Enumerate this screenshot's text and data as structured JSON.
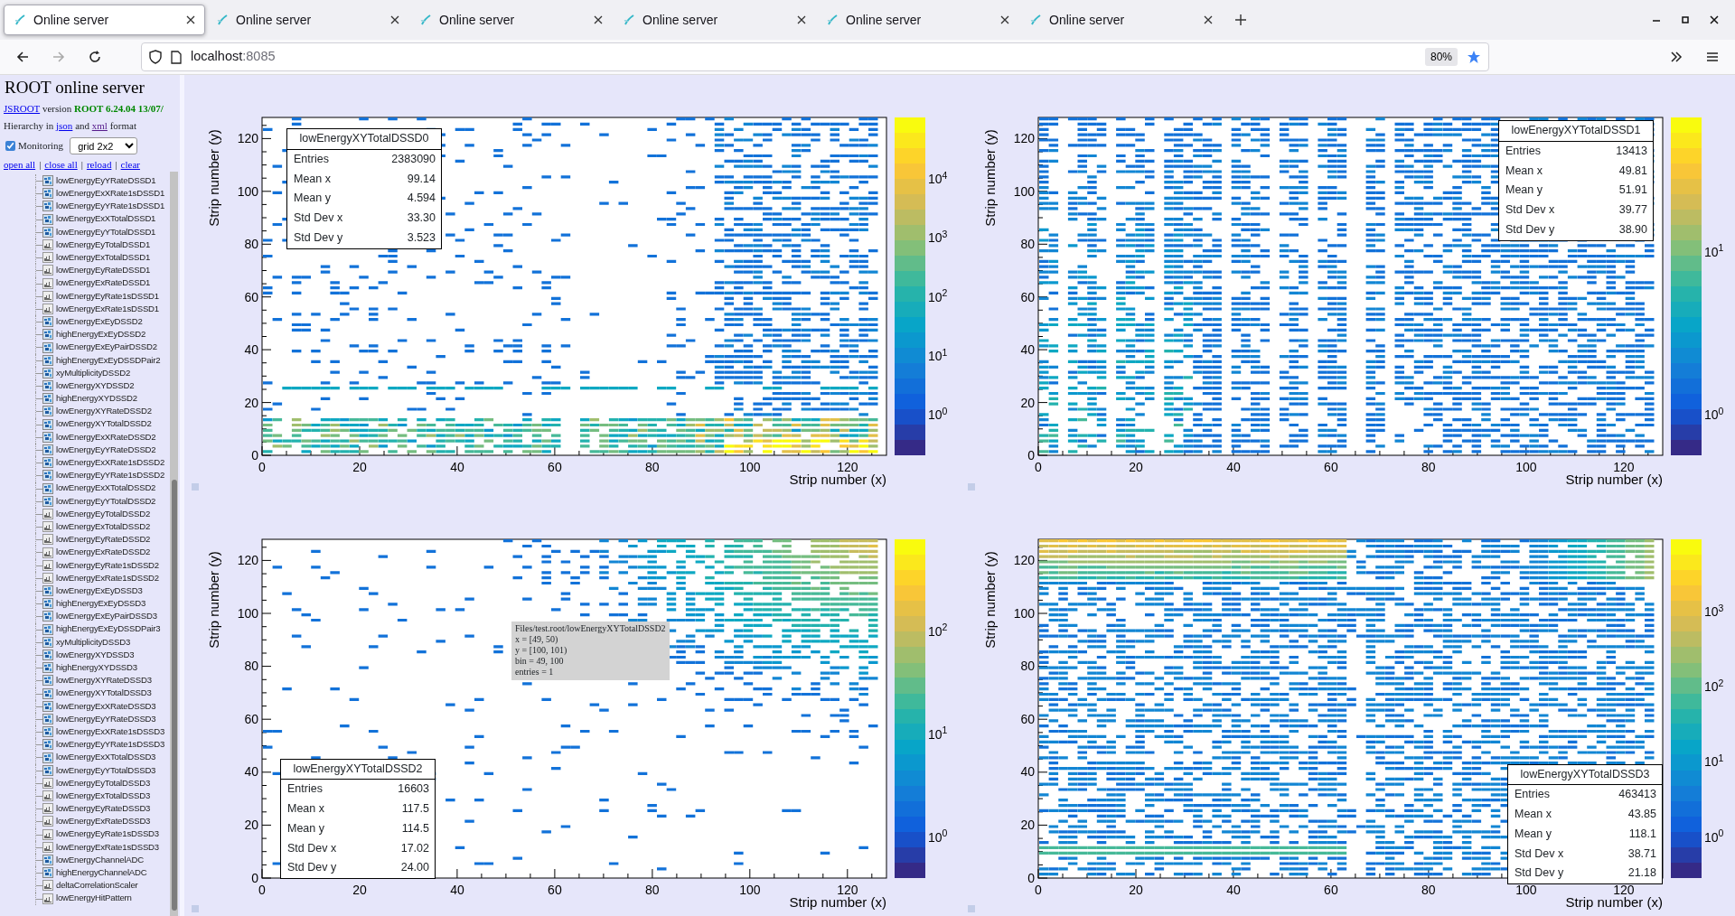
{
  "browser": {
    "tabs": [
      {
        "title": "Online server",
        "selected": true
      },
      {
        "title": "Online server",
        "selected": false
      },
      {
        "title": "Online server",
        "selected": false
      },
      {
        "title": "Online server",
        "selected": false
      },
      {
        "title": "Online server",
        "selected": false
      },
      {
        "title": "Online server",
        "selected": false
      }
    ],
    "url_host": "localhost",
    "url_port": ":8085",
    "zoom": "80%"
  },
  "sidebar": {
    "title": "ROOT online server",
    "version": {
      "link": "JSROOT",
      "text": "version",
      "release": "ROOT 6.24.04 13/07/"
    },
    "hierarchy": {
      "prefix": "Hierarchy in",
      "link_json": "json",
      "middle": "and",
      "link_xml": "xml",
      "suffix": "format"
    },
    "monitoring": {
      "label": "Monitoring",
      "checked": true
    },
    "layout_select": "grid 2x2",
    "actions": [
      {
        "kind": "link",
        "text": "open all"
      },
      {
        "kind": "separator",
        "text": "|"
      },
      {
        "kind": "link",
        "text": "close all"
      },
      {
        "kind": "separator",
        "text": "|"
      },
      {
        "kind": "link",
        "text": "reload"
      },
      {
        "kind": "separator",
        "text": "|"
      },
      {
        "kind": "link",
        "text": "clear"
      }
    ],
    "items": [
      {
        "name": "lowEnergyEyYRateDSSD1",
        "kind": "th2"
      },
      {
        "name": "lowEnergyExXRate1sDSSD1",
        "kind": "th2"
      },
      {
        "name": "lowEnergyEyYRate1sDSSD1",
        "kind": "th2"
      },
      {
        "name": "lowEnergyExXTotalDSSD1",
        "kind": "th2"
      },
      {
        "name": "lowEnergyEyYTotalDSSD1",
        "kind": "th2"
      },
      {
        "name": "lowEnergyEyTotalDSSD1",
        "kind": "th1"
      },
      {
        "name": "lowEnergyExTotalDSSD1",
        "kind": "th1"
      },
      {
        "name": "lowEnergyEyRateDSSD1",
        "kind": "th1"
      },
      {
        "name": "lowEnergyExRateDSSD1",
        "kind": "th1"
      },
      {
        "name": "lowEnergyEyRate1sDSSD1",
        "kind": "th1"
      },
      {
        "name": "lowEnergyExRate1sDSSD1",
        "kind": "th1"
      },
      {
        "name": "lowEnergyExEyDSSD2",
        "kind": "th2"
      },
      {
        "name": "highEnergyExEyDSSD2",
        "kind": "th2"
      },
      {
        "name": "lowEnergyExEyPairDSSD2",
        "kind": "th2"
      },
      {
        "name": "highEnergyExEyDSSDPair2",
        "kind": "th2"
      },
      {
        "name": "xyMultiplicityDSSD2",
        "kind": "th2"
      },
      {
        "name": "lowEnergyXYDSSD2",
        "kind": "th2"
      },
      {
        "name": "highEnergyXYDSSD2",
        "kind": "th2"
      },
      {
        "name": "lowEnergyXYRateDSSD2",
        "kind": "th2"
      },
      {
        "name": "lowEnergyXYTotalDSSD2",
        "kind": "th2"
      },
      {
        "name": "lowEnergyExXRateDSSD2",
        "kind": "th2"
      },
      {
        "name": "lowEnergyEyYRateDSSD2",
        "kind": "th2"
      },
      {
        "name": "lowEnergyExXRate1sDSSD2",
        "kind": "th2"
      },
      {
        "name": "lowEnergyEyYRate1sDSSD2",
        "kind": "th2"
      },
      {
        "name": "lowEnergyExXTotalDSSD2",
        "kind": "th2"
      },
      {
        "name": "lowEnergyEyYTotalDSSD2",
        "kind": "th2"
      },
      {
        "name": "lowEnergyEyTotalDSSD2",
        "kind": "th1"
      },
      {
        "name": "lowEnergyExTotalDSSD2",
        "kind": "th1"
      },
      {
        "name": "lowEnergyEyRateDSSD2",
        "kind": "th1"
      },
      {
        "name": "lowEnergyExRateDSSD2",
        "kind": "th1"
      },
      {
        "name": "lowEnergyEyRate1sDSSD2",
        "kind": "th1"
      },
      {
        "name": "lowEnergyExRate1sDSSD2",
        "kind": "th1"
      },
      {
        "name": "lowEnergyExEyDSSD3",
        "kind": "th2"
      },
      {
        "name": "highEnergyExEyDSSD3",
        "kind": "th2"
      },
      {
        "name": "lowEnergyExEyPairDSSD3",
        "kind": "th2"
      },
      {
        "name": "highEnergyExEyDSSDPair3",
        "kind": "th2"
      },
      {
        "name": "xyMultiplicityDSSD3",
        "kind": "th2"
      },
      {
        "name": "lowEnergyXYDSSD3",
        "kind": "th2"
      },
      {
        "name": "highEnergyXYDSSD3",
        "kind": "th2"
      },
      {
        "name": "lowEnergyXYRateDSSD3",
        "kind": "th2"
      },
      {
        "name": "lowEnergyXYTotalDSSD3",
        "kind": "th2"
      },
      {
        "name": "lowEnergyExXRateDSSD3",
        "kind": "th2"
      },
      {
        "name": "lowEnergyEyYRateDSSD3",
        "kind": "th2"
      },
      {
        "name": "lowEnergyExXRate1sDSSD3",
        "kind": "th2"
      },
      {
        "name": "lowEnergyEyYRate1sDSSD3",
        "kind": "th2"
      },
      {
        "name": "lowEnergyExXTotalDSSD3",
        "kind": "th2"
      },
      {
        "name": "lowEnergyEyYTotalDSSD3",
        "kind": "th2"
      },
      {
        "name": "lowEnergyEyTotalDSSD3",
        "kind": "th1"
      },
      {
        "name": "lowEnergyExTotalDSSD3",
        "kind": "th1"
      },
      {
        "name": "lowEnergyEyRateDSSD3",
        "kind": "th1"
      },
      {
        "name": "lowEnergyExRateDSSD3",
        "kind": "th1"
      },
      {
        "name": "lowEnergyEyRate1sDSSD3",
        "kind": "th1"
      },
      {
        "name": "lowEnergyExRate1sDSSD3",
        "kind": "th1"
      },
      {
        "name": "lowEnergyChannelADC",
        "kind": "th2"
      },
      {
        "name": "highEnergyChannelADC",
        "kind": "th2"
      },
      {
        "name": "deltaCorrelationScaler",
        "kind": "th1"
      },
      {
        "name": "lowEnergyHitPattern",
        "kind": "th1"
      }
    ]
  },
  "panels": [
    {
      "title": "lowEnergyXYTotalDSSD0",
      "stats": [
        {
          "label": "Entries",
          "value": "2383090"
        },
        {
          "label": "Mean x",
          "value": "99.14"
        },
        {
          "label": "Mean y",
          "value": "4.594"
        },
        {
          "label": "Std Dev x",
          "value": "33.30"
        },
        {
          "label": "Std Dev y",
          "value": "3.523"
        }
      ],
      "xaxis_title": "Strip number (x)",
      "yaxis_title": "Strip number (y)",
      "xticks": [
        "0",
        "20",
        "40",
        "60",
        "80",
        "100",
        "120"
      ],
      "yticks": [
        "120",
        "100",
        "80",
        "60",
        "40",
        "20",
        "0"
      ],
      "colorbar_labels": [
        "10$^{4}$",
        "10$^{3}$",
        "10$^{2}$",
        "10$^{1}$",
        "10$^{0}$"
      ]
    },
    {
      "title": "lowEnergyXYTotalDSSD1",
      "stats": [
        {
          "label": "Entries",
          "value": "13413"
        },
        {
          "label": "Mean x",
          "value": "49.81"
        },
        {
          "label": "Mean y",
          "value": "51.91"
        },
        {
          "label": "Std Dev x",
          "value": "39.77"
        },
        {
          "label": "Std Dev y",
          "value": "38.90"
        }
      ],
      "xaxis_title": "Strip number (x)",
      "yaxis_title": "Strip number (y)",
      "xticks": [
        "0",
        "20",
        "40",
        "60",
        "80",
        "100",
        "120"
      ],
      "yticks": [
        "120",
        "100",
        "80",
        "60",
        "40",
        "20",
        "0"
      ],
      "colorbar_labels": [
        "10$^{1}$",
        "10$^{0}$"
      ]
    },
    {
      "title": "lowEnergyXYTotalDSSD2",
      "stats": [
        {
          "label": "Entries",
          "value": "16603"
        },
        {
          "label": "Mean x",
          "value": "117.5"
        },
        {
          "label": "Mean y",
          "value": "114.5"
        },
        {
          "label": "Std Dev x",
          "value": "17.02"
        },
        {
          "label": "Std Dev y",
          "value": "24.00"
        }
      ],
      "xaxis_title": "Strip number (x)",
      "yaxis_title": "Strip number (y)",
      "xticks": [
        "0",
        "20",
        "40",
        "60",
        "80",
        "100",
        "120"
      ],
      "yticks": [
        "120",
        "100",
        "80",
        "60",
        "40",
        "20",
        "0"
      ],
      "colorbar_labels": [
        "10$^{2}$",
        "10$^{1}$",
        "10$^{0}$"
      ],
      "tooltip": [
        "Files/test.root/lowEnergyXYTotalDSSD2",
        "x = [49, 50)",
        "y = [100, 101)",
        "bin = 49, 100",
        "entries = 1"
      ]
    },
    {
      "title": "lowEnergyXYTotalDSSD3",
      "stats": [
        {
          "label": "Entries",
          "value": "463413"
        },
        {
          "label": "Mean x",
          "value": "43.85"
        },
        {
          "label": "Mean y",
          "value": "118.1"
        },
        {
          "label": "Std Dev x",
          "value": "38.71"
        },
        {
          "label": "Std Dev y",
          "value": "21.18"
        }
      ],
      "xaxis_title": "Strip number (x)",
      "yaxis_title": "Strip number (y)",
      "xticks": [
        "0",
        "20",
        "40",
        "60",
        "80",
        "100",
        "120"
      ],
      "yticks": [
        "120",
        "100",
        "80",
        "60",
        "40",
        "20",
        "0"
      ],
      "colorbar_labels": [
        "10$^{3}$",
        "10$^{2}$",
        "10$^{1}$",
        "10$^{0}$"
      ]
    }
  ]
}
